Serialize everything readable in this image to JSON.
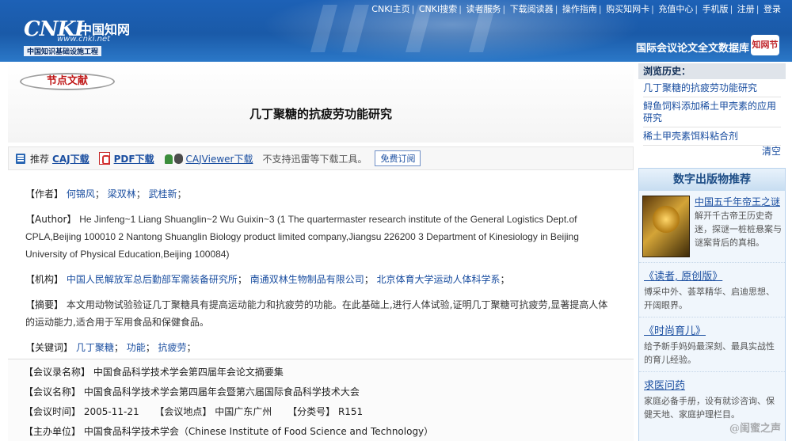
{
  "topnav": {
    "items": [
      "CNKI主页",
      "CNKI搜索",
      "读者服务",
      "下载阅读器",
      "操作指南",
      "购买知网卡",
      "充值中心",
      "手机版",
      "注册",
      "登录"
    ]
  },
  "logo": {
    "mark": "CNKI",
    "cn": "中国知网",
    "url": "www.cnki.net",
    "sub": "中国知识基础设施工程"
  },
  "header": {
    "db_title": "国际会议论文全文数据库",
    "seal": "知网节"
  },
  "node_badge": "节点文献",
  "paper_title": "几丁聚糖的抗疲劳功能研究",
  "download": {
    "recommend": "推荐",
    "caj": "CAJ下载",
    "pdf": "PDF下载",
    "cajviewer": "CAJViewer下载",
    "notice": "不支持迅雷等下载工具。",
    "subscribe": "免费订阅"
  },
  "meta": {
    "author_label": "【作者】",
    "authors": [
      "何锦风",
      "梁双林",
      "武桂新"
    ],
    "author_en_label": "【Author】",
    "author_en": "He Jinfeng~1 Liang Shuanglin~2 Wu Guixin~3 (1 The quartermaster research institute of the General Logistics Dept.of CPLA,Beijing 100010 2 Nantong Shuanglin Biology product limited company,Jiangsu 226200 3 Department of Kinesiology in Beijing University of Physical Education,Beijing 100084)",
    "org_label": "【机构】",
    "orgs": [
      "中国人民解放军总后勤部军需装备研究所",
      "南通双林生物制品有限公司",
      "北京体育大学运动人体科学系"
    ],
    "abstract_label": "【摘要】",
    "abstract": "本文用动物试验验证几丁聚糖具有提高运动能力和抗疲劳的功能。在此基础上,进行人体试验,证明几丁聚糖可抗疲劳,显著提高人体的运动能力,适合用于军用食品和保健食品。",
    "keywords_label": "【关键词】",
    "keywords": [
      "几丁聚糖",
      "功能",
      "抗疲劳"
    ]
  },
  "conference": {
    "proceedings_label": "【会议录名称】",
    "proceedings": "中国食品科学技术学会第四届年会论文摘要集",
    "name_label": "【会议名称】",
    "name": "中国食品科学技术学会第四届年会暨第六届国际食品科学技术大会",
    "time_label": "【会议时间】",
    "time": "2005-11-21",
    "place_label": "【会议地点】",
    "place": "中国广东广州",
    "class_label": "【分类号】",
    "class": "R151",
    "host_label": "【主办单位】",
    "host": "中国食品科学技术学会（Chinese Institute of Food Science and Technology）"
  },
  "history": {
    "title": "浏览历史：",
    "items": [
      "几丁聚糖的抗疲劳功能研究",
      "鲟鱼饲料添加稀土甲壳素的应用研究",
      "稀土甲壳素饵料粘合剂"
    ],
    "clear": "清空"
  },
  "recommend": {
    "title": "数字出版物推荐",
    "book_title": "中国五千年帝王之谜",
    "book_desc": "解开千古帝王历史奇迷，探谜一桩桩悬案与谜案背后的真相。",
    "mags": [
      {
        "title": "《读者, 原创版》",
        "desc": "博采中外、荟萃精华、启迪思想、开阔眼界。"
      },
      {
        "title": "《时尚育儿》",
        "desc": "给予新手妈妈最深刻、最具实战性的育儿经验。"
      },
      {
        "title": "求医问药",
        "desc": "家庭必备手册，设有就诊咨询、保健天地、家庭护理栏目。"
      }
    ]
  },
  "watermark": "@闺蜜之声"
}
